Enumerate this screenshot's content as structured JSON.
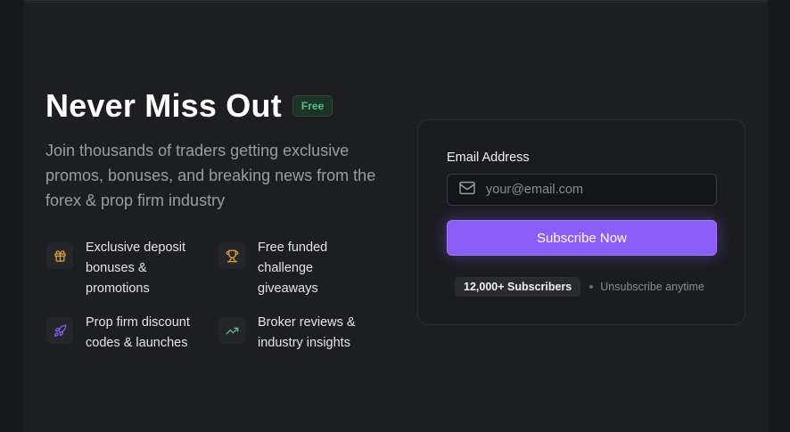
{
  "hero": {
    "title": "Never Miss Out",
    "badge": "Free",
    "subtitle": "Join thousands of traders getting exclusive promos, bonuses, and breaking news from the forex & prop firm industry"
  },
  "features": [
    {
      "icon": "gift-icon",
      "color": "#e2a33b",
      "text": "Exclusive deposit bonuses & promotions"
    },
    {
      "icon": "trophy-icon",
      "color": "#e2a33b",
      "text": "Free funded challenge giveaways"
    },
    {
      "icon": "rocket-icon",
      "color": "#8b5cf6",
      "text": "Prop firm discount codes & launches"
    },
    {
      "icon": "trending-up-icon",
      "color": "#4fc38a",
      "text": "Broker reviews & industry insights"
    }
  ],
  "form": {
    "email_label": "Email Address",
    "email_placeholder": "your@email.com",
    "email_value": "",
    "submit_label": "Subscribe Now",
    "subscribers": "12,000+ Subscribers",
    "unsubscribe_note": "Unsubscribe anytime"
  },
  "colors": {
    "accent": "#8b5cf6",
    "success": "#4fc38a",
    "warning": "#e2a33b"
  }
}
